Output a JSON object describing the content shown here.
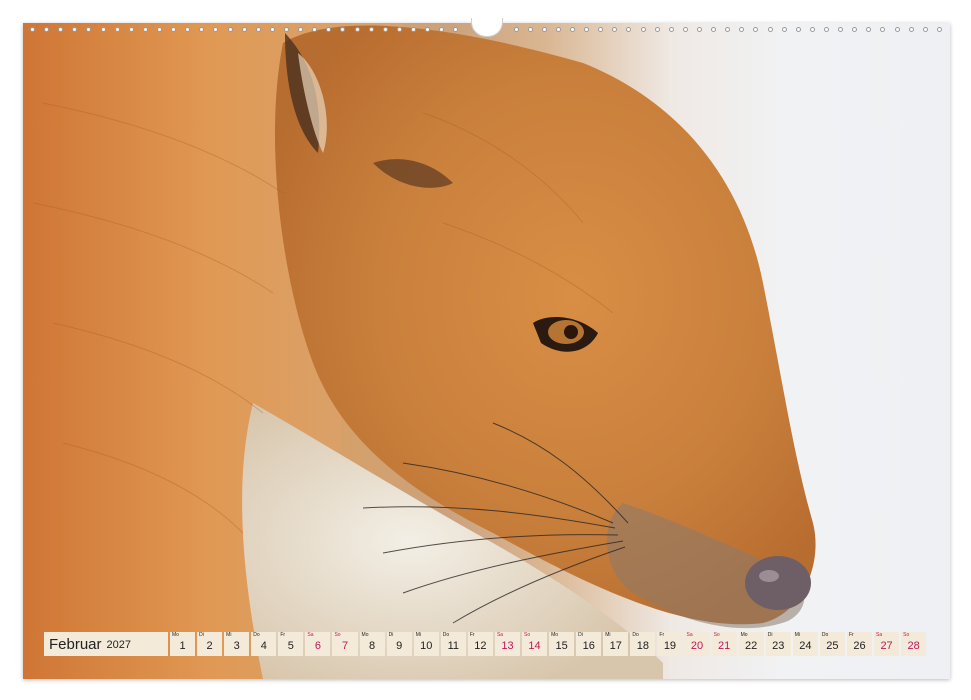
{
  "calendar": {
    "month": "Februar",
    "year": "2027",
    "days": [
      {
        "abbr": "Mo",
        "num": "1"
      },
      {
        "abbr": "Di",
        "num": "2"
      },
      {
        "abbr": "Mi",
        "num": "3"
      },
      {
        "abbr": "Do",
        "num": "4"
      },
      {
        "abbr": "Fr",
        "num": "5"
      },
      {
        "abbr": "Sa",
        "num": "6"
      },
      {
        "abbr": "So",
        "num": "7"
      },
      {
        "abbr": "Mo",
        "num": "8"
      },
      {
        "abbr": "Di",
        "num": "9"
      },
      {
        "abbr": "Mi",
        "num": "10"
      },
      {
        "abbr": "Do",
        "num": "11"
      },
      {
        "abbr": "Fr",
        "num": "12"
      },
      {
        "abbr": "Sa",
        "num": "13"
      },
      {
        "abbr": "So",
        "num": "14"
      },
      {
        "abbr": "Mo",
        "num": "15"
      },
      {
        "abbr": "Di",
        "num": "16"
      },
      {
        "abbr": "Mi",
        "num": "17"
      },
      {
        "abbr": "Do",
        "num": "18"
      },
      {
        "abbr": "Fr",
        "num": "19"
      },
      {
        "abbr": "Sa",
        "num": "20"
      },
      {
        "abbr": "So",
        "num": "21"
      },
      {
        "abbr": "Mo",
        "num": "22"
      },
      {
        "abbr": "Di",
        "num": "23"
      },
      {
        "abbr": "Mi",
        "num": "24"
      },
      {
        "abbr": "Do",
        "num": "25"
      },
      {
        "abbr": "Fr",
        "num": "26"
      },
      {
        "abbr": "Sa",
        "num": "27"
      },
      {
        "abbr": "So",
        "num": "28"
      }
    ]
  },
  "colors": {
    "cell_background": "#f3ead9",
    "weekday_text": "#222222",
    "weekend_text": "#c2185b"
  },
  "photo": {
    "subject_icon": "fox-portrait-image"
  }
}
